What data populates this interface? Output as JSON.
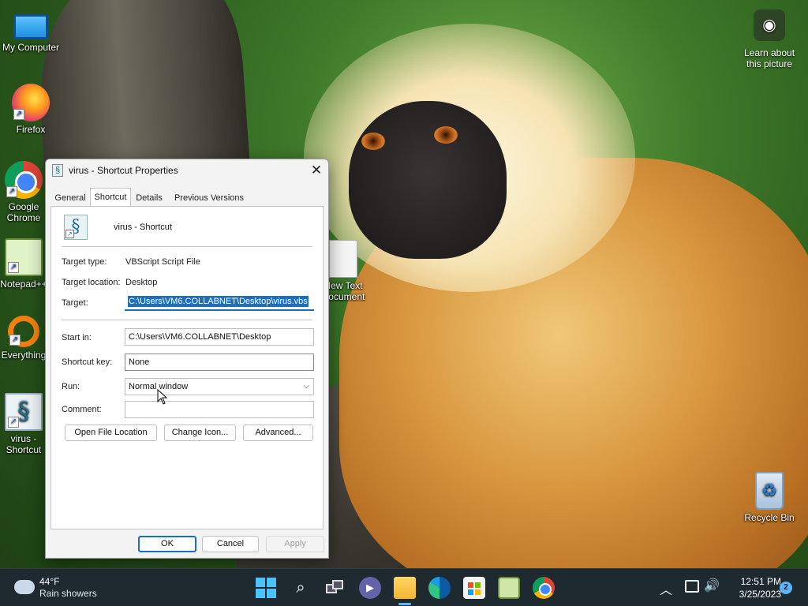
{
  "desktop": {
    "icons": {
      "my_computer": "My Computer",
      "firefox": "Firefox",
      "chrome": "Google Chrome",
      "notepad": "Notepad++",
      "everything": "Everything",
      "virus": "virus - Shortcut",
      "textdoc": "New Text Document",
      "recycle_bin": "Recycle Bin"
    },
    "camera_widget": {
      "line1": "Learn about",
      "line2": "this picture"
    }
  },
  "dialog": {
    "title": "virus - Shortcut Properties",
    "tabs": [
      "General",
      "Shortcut",
      "Details",
      "Previous Versions"
    ],
    "active_tab": "Shortcut",
    "file_name": "virus - Shortcut",
    "target_type_label": "Target type:",
    "target_type_value": "VBScript Script File",
    "target_location_label": "Target location:",
    "target_location_value": "Desktop",
    "target_label": "Target:",
    "target_value": "C:\\Users\\VM6.COLLABNET\\Desktop\\virus.vbs",
    "start_in_label": "Start in:",
    "start_in_value": "C:\\Users\\VM6.COLLABNET\\Desktop",
    "shortcut_key_label": "Shortcut key:",
    "shortcut_key_value": "None",
    "run_label": "Run:",
    "run_value": "Normal window",
    "comment_label": "Comment:",
    "comment_value": "",
    "buttons": {
      "open_location": "Open File Location",
      "change_icon": "Change Icon...",
      "advanced": "Advanced..."
    },
    "footer": {
      "ok": "OK",
      "cancel": "Cancel",
      "apply": "Apply"
    }
  },
  "taskbar": {
    "weather": {
      "temp": "44°F",
      "condition": "Rain showers"
    },
    "clock": {
      "time": "12:51 PM",
      "date": "3/25/2023"
    },
    "notification_count": "2"
  },
  "colors": {
    "accent": "#1a6fc4",
    "taskbar": "#1f2a30"
  }
}
